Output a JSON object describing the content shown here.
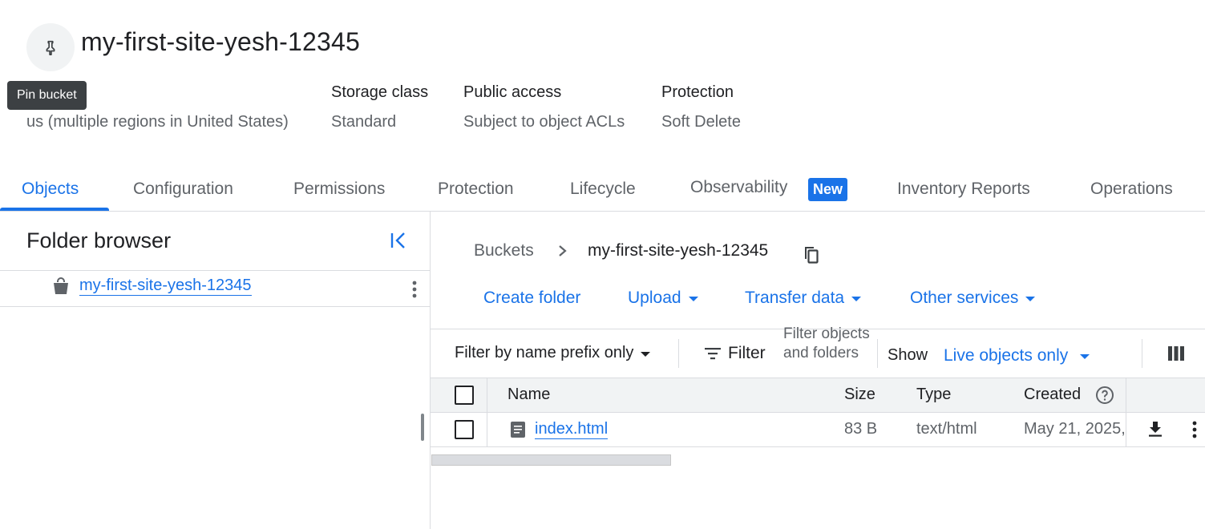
{
  "header": {
    "bucket_name": "my-first-site-yesh-12345",
    "pin_tooltip": "Pin bucket"
  },
  "meta": {
    "location_value": "us (multiple regions in United States)",
    "storage_class_label": "Storage class",
    "storage_class_value": "Standard",
    "public_access_label": "Public access",
    "public_access_value": "Subject to object ACLs",
    "protection_label": "Protection",
    "protection_value": "Soft Delete"
  },
  "tabs": [
    {
      "label": "Objects",
      "active": true
    },
    {
      "label": "Configuration"
    },
    {
      "label": "Permissions"
    },
    {
      "label": "Protection"
    },
    {
      "label": "Lifecycle"
    },
    {
      "label": "Observability",
      "badge": "New"
    },
    {
      "label": "Inventory Reports"
    },
    {
      "label": "Operations"
    }
  ],
  "folder_browser": {
    "title": "Folder browser",
    "bucket": "my-first-site-yesh-12345"
  },
  "breadcrumb": {
    "root": "Buckets",
    "current": "my-first-site-yesh-12345"
  },
  "actions": {
    "create_folder": "Create folder",
    "upload": "Upload",
    "transfer_data": "Transfer data",
    "other_services": "Other services"
  },
  "filter": {
    "prefix_mode": "Filter by name prefix only",
    "filter_label": "Filter",
    "placeholder": "Filter objects and folders",
    "show_label": "Show",
    "show_value": "Live objects only"
  },
  "table": {
    "columns": {
      "name": "Name",
      "size": "Size",
      "type": "Type",
      "created": "Created"
    },
    "rows": [
      {
        "name": "index.html",
        "size": "83 B",
        "type": "text/html",
        "created": "May 21, 2025,"
      }
    ]
  },
  "colors": {
    "accent": "#1a73e8",
    "text": "#202124",
    "muted": "#5f6368",
    "divider": "#dadce0"
  }
}
